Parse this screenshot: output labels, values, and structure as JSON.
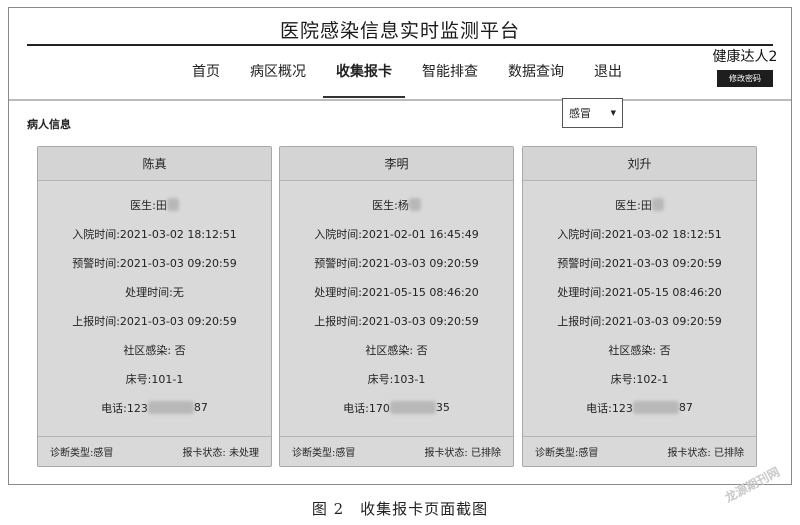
{
  "app_title": "医院感染信息实时监测平台",
  "nav": [
    {
      "label": "首页"
    },
    {
      "label": "病区概况"
    },
    {
      "label": "收集报卡",
      "active": true
    },
    {
      "label": "智能排查"
    },
    {
      "label": "数据查询"
    },
    {
      "label": "退出"
    }
  ],
  "user": {
    "name": "健康达人2",
    "change_password_label": "修改密码"
  },
  "section_label": "病人信息",
  "filter": {
    "selected": "感冒"
  },
  "cards": [
    {
      "patient": "陈真",
      "doctor_label": "医生:",
      "doctor": "田",
      "admit": "入院时间:2021-03-02 18:12:51",
      "alert": "预警时间:2021-03-03 09:20:59",
      "handle": "处理时间:无",
      "report": "上报时间:2021-03-03 09:20:59",
      "community": "社区感染: 否",
      "bed": "床号:101-1",
      "phone_prefix": "电话:123",
      "phone_suffix": "87",
      "diagnosis": "诊断类型:感冒",
      "status": "报卡状态: 未处理"
    },
    {
      "patient": "李明",
      "doctor_label": "医生:",
      "doctor": "杨",
      "admit": "入院时间:2021-02-01 16:45:49",
      "alert": "预警时间:2021-03-03 09:20:59",
      "handle": "处理时间:2021-05-15 08:46:20",
      "report": "上报时间:2021-03-03 09:20:59",
      "community": "社区感染: 否",
      "bed": "床号:103-1",
      "phone_prefix": "电话:170",
      "phone_suffix": "35",
      "diagnosis": "诊断类型:感冒",
      "status": "报卡状态: 已排除"
    },
    {
      "patient": "刘升",
      "doctor_label": "医生:",
      "doctor": "田",
      "admit": "入院时间:2021-03-02 18:12:51",
      "alert": "预警时间:2021-03-03 09:20:59",
      "handle": "处理时间:2021-05-15 08:46:20",
      "report": "上报时间:2021-03-03 09:20:59",
      "community": "社区感染: 否",
      "bed": "床号:102-1",
      "phone_prefix": "电话:123",
      "phone_suffix": "87",
      "diagnosis": "诊断类型:感冒",
      "status": "报卡状态: 已排除"
    }
  ],
  "caption": "图 2　收集报卡页面截图",
  "watermark": "龙源期刊网"
}
